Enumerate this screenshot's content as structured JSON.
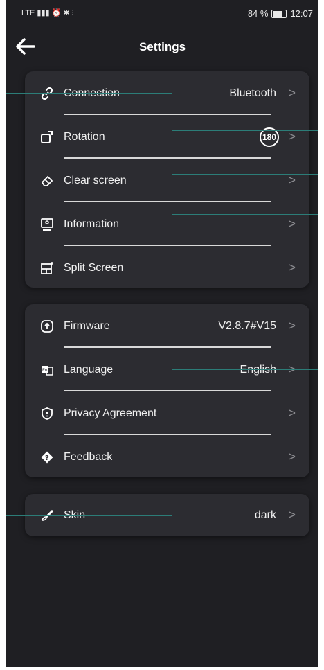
{
  "status": {
    "left": "LTE ▮▮▮ ⏰ ✱ ⫶",
    "battery": "84 %",
    "time": "12:07"
  },
  "header": {
    "title": "Settings"
  },
  "group1": [
    {
      "label": "Connection",
      "value": "Bluetooth",
      "icon": "link-icon"
    },
    {
      "label": "Rotation",
      "value": "180",
      "icon": "rotate-icon"
    },
    {
      "label": "Clear screen",
      "value": "",
      "icon": "eraser-icon"
    },
    {
      "label": "Information",
      "value": "",
      "icon": "monitor-icon"
    },
    {
      "label": "Split Screen",
      "value": "",
      "icon": "split-screen-icon"
    }
  ],
  "group2": [
    {
      "label": "Firmware",
      "value": "V2.8.7#V15",
      "icon": "firmware-icon"
    },
    {
      "label": "Language",
      "value": "English",
      "icon": "language-icon"
    },
    {
      "label": "Privacy Agreement",
      "value": "",
      "icon": "shield-icon"
    },
    {
      "label": "Feedback",
      "value": "",
      "icon": "feedback-icon"
    }
  ],
  "group3": [
    {
      "label": "Skin",
      "value": "dark",
      "icon": "brush-icon"
    }
  ],
  "chevron": ">",
  "colors": {
    "background": "#1f1f23",
    "card": "#2c2c31",
    "annotation": "#2c7d78"
  }
}
